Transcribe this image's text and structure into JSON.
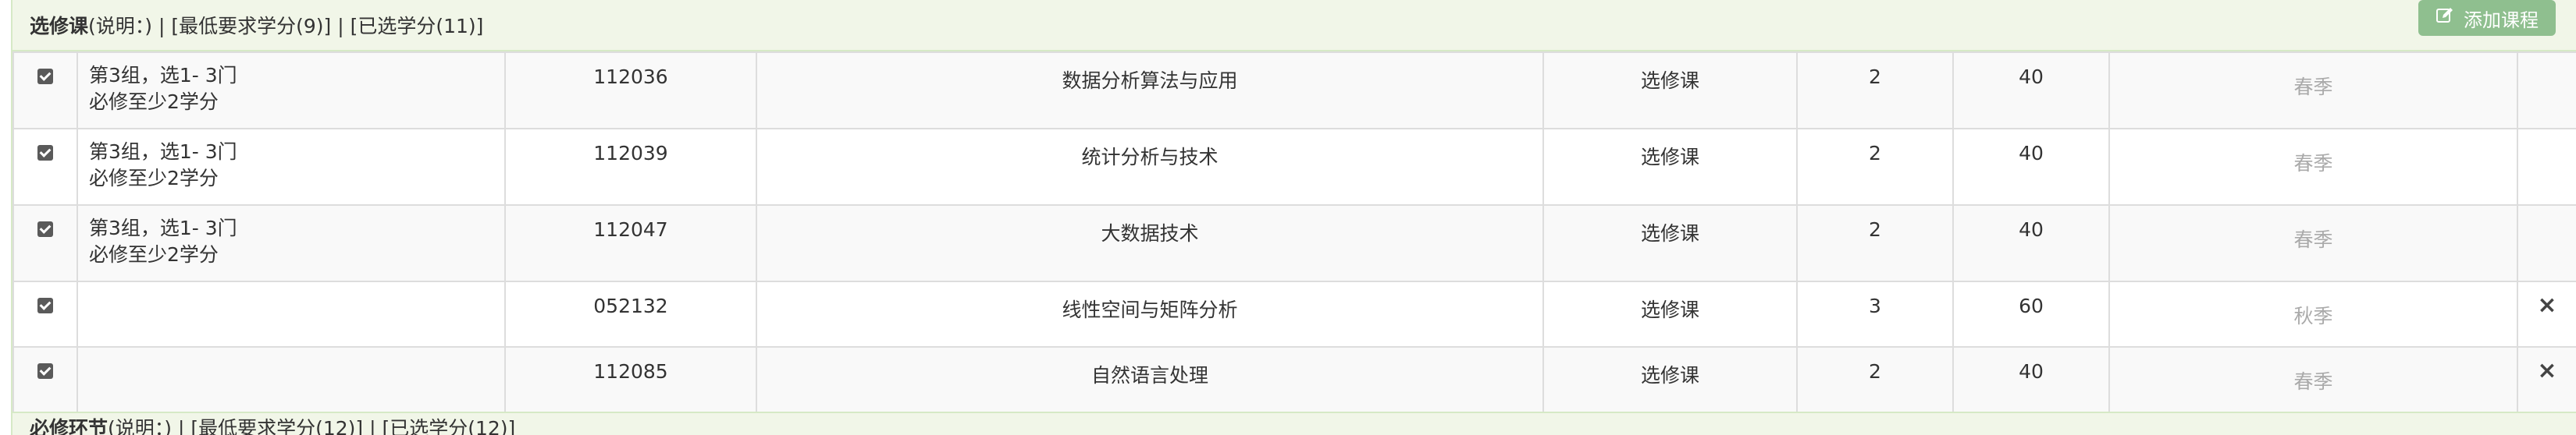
{
  "section": {
    "title": "选修课",
    "meta": "(说明：) | [最低要求学分(9)] | [已选学分(11)]",
    "add_button": "添加课程"
  },
  "rows": [
    {
      "checked": true,
      "group_line1": "第3组，选1- 3门",
      "group_line2": "必修至少2学分",
      "code": "112036",
      "name": "数据分析算法与应用",
      "type": "选修课",
      "credits": "2",
      "hours": "40",
      "season": "春季",
      "delete": ""
    },
    {
      "checked": true,
      "group_line1": "第3组，选1- 3门",
      "group_line2": "必修至少2学分",
      "code": "112039",
      "name": "统计分析与技术",
      "type": "选修课",
      "credits": "2",
      "hours": "40",
      "season": "春季",
      "delete": ""
    },
    {
      "checked": true,
      "group_line1": "第3组，选1- 3门",
      "group_line2": "必修至少2学分",
      "code": "112047",
      "name": "大数据技术",
      "type": "选修课",
      "credits": "2",
      "hours": "40",
      "season": "春季",
      "delete": ""
    },
    {
      "checked": true,
      "group_line1": "",
      "group_line2": "",
      "code": "052132",
      "name": "线性空间与矩阵分析",
      "type": "选修课",
      "credits": "3",
      "hours": "60",
      "season": "秋季",
      "delete": "×"
    },
    {
      "checked": true,
      "group_line1": "",
      "group_line2": "",
      "code": "112085",
      "name": "自然语言处理",
      "type": "选修课",
      "credits": "2",
      "hours": "40",
      "season": "春季",
      "delete": "×"
    }
  ],
  "next_section": {
    "title": "必修环节",
    "meta": "(说明：) | [最低要求学分(12)] | [已选学分(12)]"
  }
}
